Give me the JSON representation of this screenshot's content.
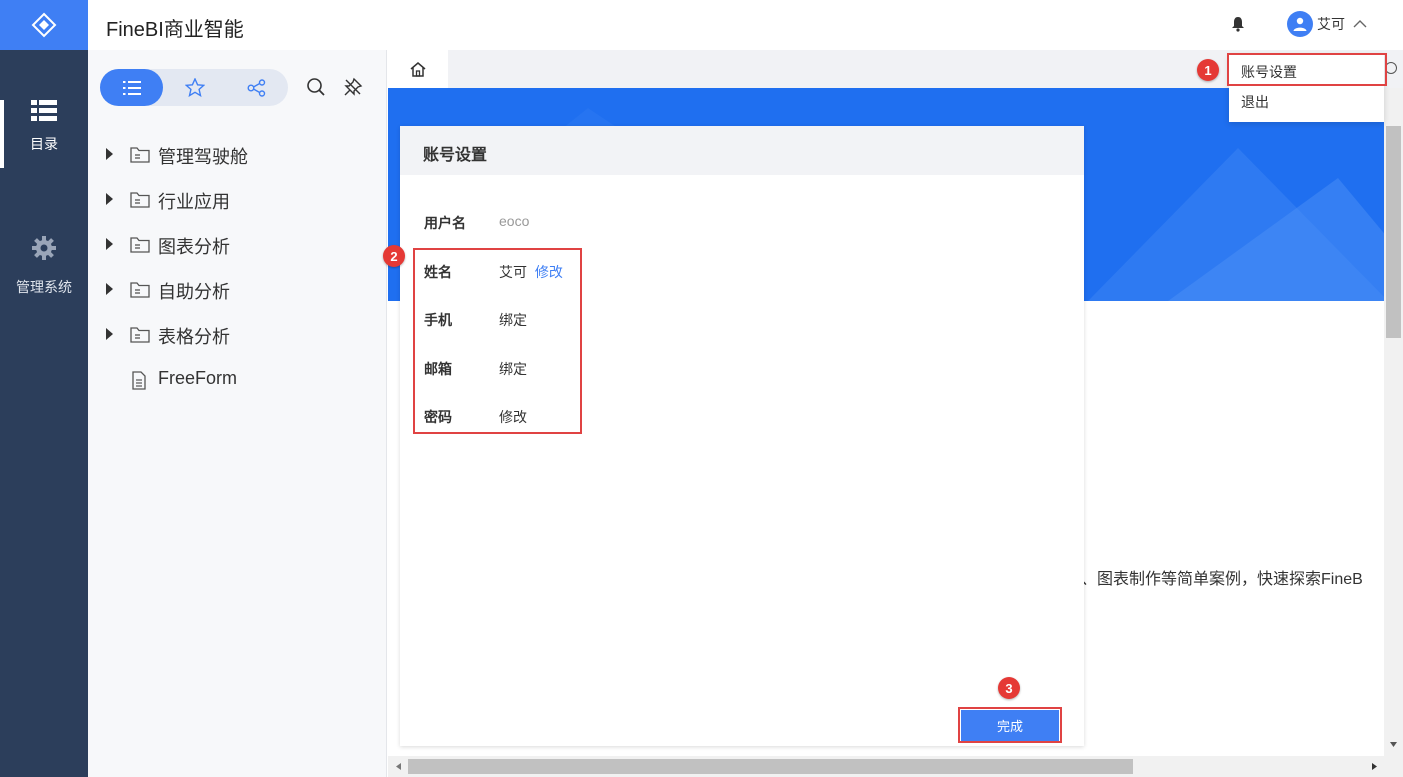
{
  "app": {
    "title": "FineBI商业智能"
  },
  "leftnav": {
    "items": [
      {
        "label": "目录",
        "icon": "list-icon"
      },
      {
        "label": "管理系统",
        "icon": "gear-icon"
      }
    ]
  },
  "user": {
    "name": "艾可"
  },
  "user_menu": {
    "items": [
      "账号设置",
      "退出"
    ]
  },
  "directory": {
    "items": [
      {
        "label": "管理驾驶舱",
        "type": "folder"
      },
      {
        "label": "行业应用",
        "type": "folder"
      },
      {
        "label": "图表分析",
        "type": "folder"
      },
      {
        "label": "自助分析",
        "type": "folder"
      },
      {
        "label": "表格分析",
        "type": "folder"
      },
      {
        "label": "FreeForm",
        "type": "file"
      }
    ]
  },
  "background_text": "、图表制作等简单案例，快速探索FineB",
  "dialog": {
    "title": "账号设置",
    "fields": [
      {
        "label": "用户名",
        "value": "eoco",
        "action": ""
      },
      {
        "label": "姓名",
        "value": "艾可",
        "action": "修改"
      },
      {
        "label": "手机",
        "value": "",
        "action": "绑定"
      },
      {
        "label": "邮箱",
        "value": "",
        "action": "绑定"
      },
      {
        "label": "密码",
        "value": "",
        "action": "修改"
      }
    ],
    "done_label": "完成"
  },
  "annotations": {
    "markers": [
      "1",
      "2",
      "3"
    ]
  },
  "colors": {
    "accent": "#3f7ff4",
    "sidebar": "#2c3e5b",
    "annotation": "#e53935"
  }
}
